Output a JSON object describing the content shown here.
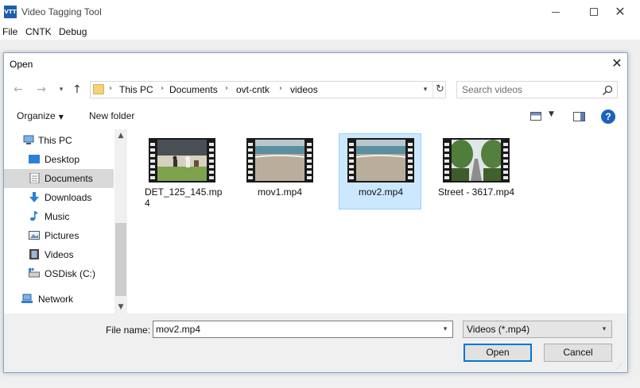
{
  "app": {
    "title": "Video Tagging Tool",
    "icon_text": "VTT",
    "menu": [
      "File",
      "CNTK",
      "Debug"
    ]
  },
  "dialog": {
    "title": "Open",
    "breadcrumbs": [
      "This PC",
      "Documents",
      "ovt-cntk",
      "videos"
    ],
    "search_placeholder": "Search videos",
    "toolbar": {
      "organize": "Organize",
      "new_folder": "New folder"
    },
    "nav_items": [
      {
        "label": "This PC",
        "icon": "computer-icon"
      },
      {
        "label": "Desktop",
        "icon": "desktop-icon"
      },
      {
        "label": "Documents",
        "icon": "documents-icon",
        "selected": true
      },
      {
        "label": "Downloads",
        "icon": "downloads-icon"
      },
      {
        "label": "Music",
        "icon": "music-icon"
      },
      {
        "label": "Pictures",
        "icon": "pictures-icon"
      },
      {
        "label": "Videos",
        "icon": "videos-icon"
      },
      {
        "label": "OSDisk (C:)",
        "icon": "disk-icon"
      },
      {
        "label": "Network",
        "icon": "network-icon"
      }
    ],
    "files": [
      {
        "name": "DET_125_145.mp4",
        "name_line1": "DET_125_145.mp",
        "name_line2": "4",
        "thumb": "baseball-field"
      },
      {
        "name": "mov1.mp4",
        "thumb": "beach"
      },
      {
        "name": "mov2.mp4",
        "thumb": "beach",
        "selected": true
      },
      {
        "name": "Street - 3617.mp4",
        "thumb": "tree-lined-street"
      }
    ],
    "file_name_label": "File name:",
    "file_name_value": "mov2.mp4",
    "file_type": "Videos (*.mp4)",
    "open_label": "Open",
    "cancel_label": "Cancel"
  },
  "colors": {
    "selection_bg": "#cce8ff",
    "selection_border": "#99d1ff",
    "accent": "#0078d7",
    "help_icon": "#1a64b8"
  }
}
